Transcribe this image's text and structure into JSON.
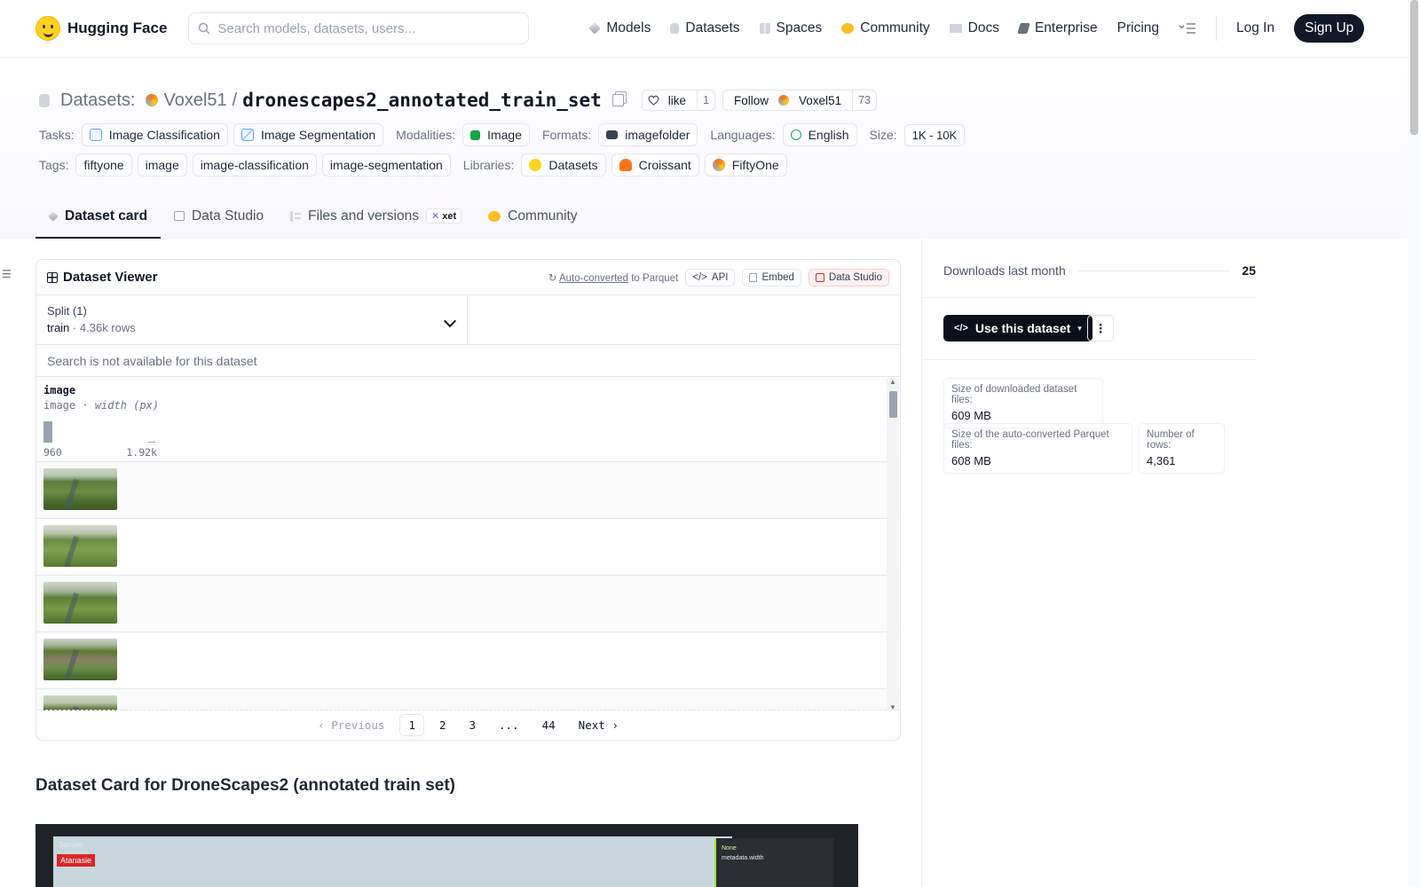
{
  "nav": {
    "brand": "Hugging Face",
    "search_placeholder": "Search models, datasets, users...",
    "links": [
      {
        "label": "Models",
        "icon": "models-icon"
      },
      {
        "label": "Datasets",
        "icon": "datasets-icon"
      },
      {
        "label": "Spaces",
        "icon": "spaces-icon"
      },
      {
        "label": "Community",
        "icon": "community-icon"
      },
      {
        "label": "Docs",
        "icon": "docs-icon"
      },
      {
        "label": "Enterprise",
        "icon": "enterprise-icon"
      },
      {
        "label": "Pricing"
      }
    ],
    "login": "Log In",
    "signup": "Sign Up"
  },
  "header": {
    "crumb": "Datasets:",
    "owner": "Voxel51",
    "slash": "/",
    "name": "dronescapes2_annotated_train_set",
    "like_label": "like",
    "like_count": "1",
    "follow_label": "Follow",
    "follow_owner": "Voxel51",
    "follow_count": "73",
    "tasks_label": "Tasks:",
    "tasks": [
      "Image Classification",
      "Image Segmentation"
    ],
    "modalities_label": "Modalities:",
    "modality": "Image",
    "formats_label": "Formats:",
    "format": "imagefolder",
    "languages_label": "Languages:",
    "language": "English",
    "size_label": "Size:",
    "size": "1K - 10K",
    "tags_label": "Tags:",
    "tags": [
      "fiftyone",
      "image",
      "image-classification",
      "image-segmentation"
    ],
    "libraries_label": "Libraries:",
    "libraries": [
      "Datasets",
      "Croissant",
      "FiftyOne"
    ]
  },
  "tabs": [
    {
      "label": "Dataset card",
      "active": true
    },
    {
      "label": "Data Studio"
    },
    {
      "label": "Files and versions",
      "badge": "xet"
    },
    {
      "label": "Community"
    }
  ],
  "viewer": {
    "title": "Dataset Viewer",
    "auto_converted": "Auto-converted",
    "to_parquet": "to Parquet",
    "api": "API",
    "embed": "Embed",
    "data_studio": "Data Studio",
    "split_label": "Split (1)",
    "split_name": "train",
    "split_sep": "·",
    "split_rows": "4.36k rows",
    "search_na": "Search is not available for this dataset",
    "column": {
      "name": "image",
      "type": "image",
      "sep": "·",
      "stat": "width (px)",
      "hist_min": "960",
      "hist_max": "1.92k"
    },
    "pager": {
      "prev": "Previous",
      "pages": [
        "1",
        "2",
        "3",
        "...",
        "44"
      ],
      "current": "1",
      "next": "Next"
    }
  },
  "card_title": "Dataset Card for DroneScapes2 (annotated train set)",
  "screenshot_preview": {
    "sample": "Sample",
    "label": "Atanasie",
    "side_1": "None",
    "side_2": "metadata.width"
  },
  "sidebar": {
    "downloads_label": "Downloads last month",
    "downloads": "25",
    "use_dataset": "Use this dataset",
    "download_size_label": "Size of downloaded dataset files:",
    "download_size": "609 MB",
    "parquet_size_label": "Size of the auto-converted Parquet files:",
    "parquet_size": "608 MB",
    "rows_label": "Number of rows:",
    "rows": "4,361"
  }
}
